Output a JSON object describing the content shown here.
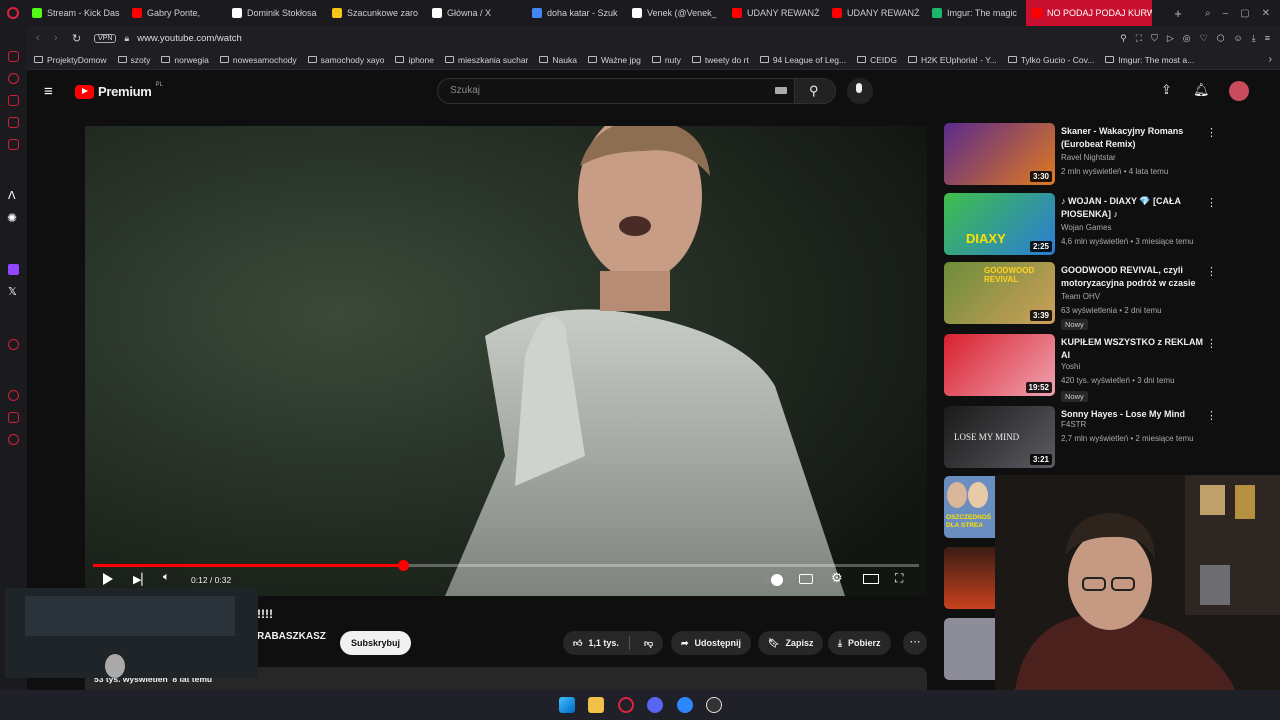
{
  "tabs": [
    {
      "label": "Stream - Kick Das",
      "color": "#53fc18"
    },
    {
      "label": "Gabry Ponte,",
      "color": "#ff0000"
    },
    {
      "label": "Dominik Stokłosa",
      "color": "#ffffff"
    },
    {
      "label": "Szacunkowe zaro",
      "color": "#f5c518"
    },
    {
      "label": "Główna / X",
      "color": "#ffffff"
    },
    {
      "label": "doha katar - Szuk",
      "color": "#4285f4"
    },
    {
      "label": "Venek (@Venek_",
      "color": "#ffffff"
    },
    {
      "label": "UDANY REWANŻ",
      "color": "#ff0000"
    },
    {
      "label": "UDANY REWANŻ",
      "color": "#ff0000"
    },
    {
      "label": "Imgur: The magic",
      "color": "#1bb76e"
    },
    {
      "label": "NO PODAJ PODAJ KURW",
      "color": "#ff0000",
      "active": true
    }
  ],
  "address": {
    "url": "www.youtube.com/watch",
    "vpn": "VPN"
  },
  "bookmarks": [
    "ProjektyDomow",
    "szoty",
    "norwegia",
    "nowesamochody",
    "samochody xayo",
    "iphone",
    "mieszkania suchar",
    "Nauka",
    "Ważne jpg",
    "nuty",
    "tweety do rt",
    "94 League of Leg...",
    "CEIDG",
    "H2K EUphoria! - Y...",
    "Tylko Gucio - Cov...",
    "Imgur: The most a..."
  ],
  "youtube": {
    "logo_text": "Premium",
    "region": "PL",
    "search_placeholder": "Szukaj",
    "player": {
      "time": "0:12 / 0:32",
      "progress": 0.375
    },
    "video_title_fragment": "!!!!",
    "channel_fragment": "RABASZKASZ",
    "subscribe_label": "Subskrybuj",
    "likes": "1,1 tys.",
    "share_label": "Udostępnij",
    "save_label": "Zapisz",
    "download_label": "Pobierz",
    "views_line": "53 tys. wyświetleń  8 lat temu",
    "accent": "#ff0000"
  },
  "recommendations": [
    {
      "title": "Skaner - Wakacyjny Romans (Eurobeat Remix)",
      "channel": "Ravel Nightstar",
      "meta": "2 mln wyświetleń • 4 lata temu",
      "duration": "3:30",
      "badge": ""
    },
    {
      "title": "♪ WOJAN - DIAXY 💎 [CAŁA PIOSENKA] ♪",
      "channel": "Wojan Games",
      "meta": "4,6 mln wyświetleń • 3 miesiące temu",
      "duration": "2:25",
      "badge": ""
    },
    {
      "title": "GOODWOOD REVIVAL, czyli motoryzacyjna podróż w czasie",
      "channel": "Team OHV",
      "meta": "63 wyświetlenia • 2 dni temu",
      "duration": "3:39",
      "badge": "Nowy"
    },
    {
      "title": "KUPIŁEM WSZYSTKO z REKLAM AI",
      "channel": "Yoshi",
      "meta": "420 tys. wyświetleń • 3 dni temu",
      "duration": "19:52",
      "badge": "Nowy"
    },
    {
      "title": "Sonny Hayes - Lose My Mind",
      "channel": "F4STR",
      "meta": "2,7 mln wyświetleń • 2 miesiące temu",
      "duration": "3:21",
      "badge": ""
    }
  ],
  "thumb_texts": {
    "diaxy": "DIAXY",
    "goodwood": "GOODWOOD REVIVAL",
    "lose": "LOSE MY MIND",
    "partial": "OSZCZĘDNOŚ DLA STREA"
  }
}
